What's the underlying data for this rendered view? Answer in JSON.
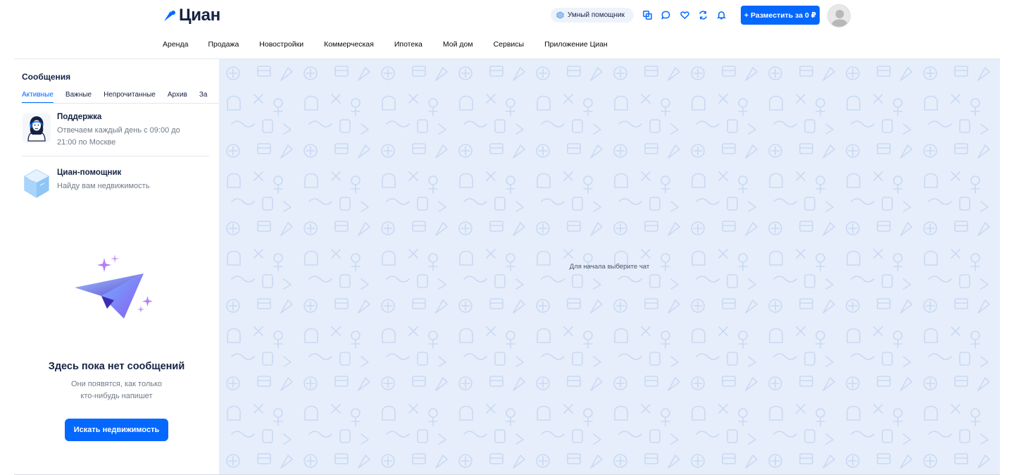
{
  "header": {
    "logo_text": "Циан",
    "assistant_label": "Умный помощник",
    "post_button_label": "+ Разместить за 0 ₽",
    "icons": [
      "compare-icon",
      "messages-icon",
      "favorites-icon",
      "saved-search-icon",
      "notifications-icon"
    ],
    "brand_color": "#0468ff"
  },
  "nav": {
    "items": [
      {
        "label": "Аренда"
      },
      {
        "label": "Продажа"
      },
      {
        "label": "Новостройки"
      },
      {
        "label": "Коммерческая"
      },
      {
        "label": "Ипотека"
      },
      {
        "label": "Мой дом"
      },
      {
        "label": "Сервисы"
      },
      {
        "label": "Приложение Циан"
      }
    ]
  },
  "sidebar": {
    "title": "Сообщения",
    "tabs": [
      {
        "label": "Активные",
        "active": true
      },
      {
        "label": "Важные"
      },
      {
        "label": "Непрочитанные"
      },
      {
        "label": "Архив"
      },
      {
        "label": "За"
      }
    ],
    "chats": [
      {
        "name": "Поддержка",
        "preview": "Отвечаем каждый день с 09:00 до 21:00 по Москве"
      },
      {
        "name": "Циан-помощник",
        "preview": "Найду вам недвижимость"
      }
    ],
    "empty": {
      "title": "Здесь пока нет сообщений",
      "subtitle_line1": "Они появятся, как только",
      "subtitle_line2": "кто-нибудь напишет",
      "button_label": "Искать недвижимость"
    }
  },
  "chat_area": {
    "placeholder": "Для начала выберите чат",
    "background_color": "#e6eefb"
  }
}
